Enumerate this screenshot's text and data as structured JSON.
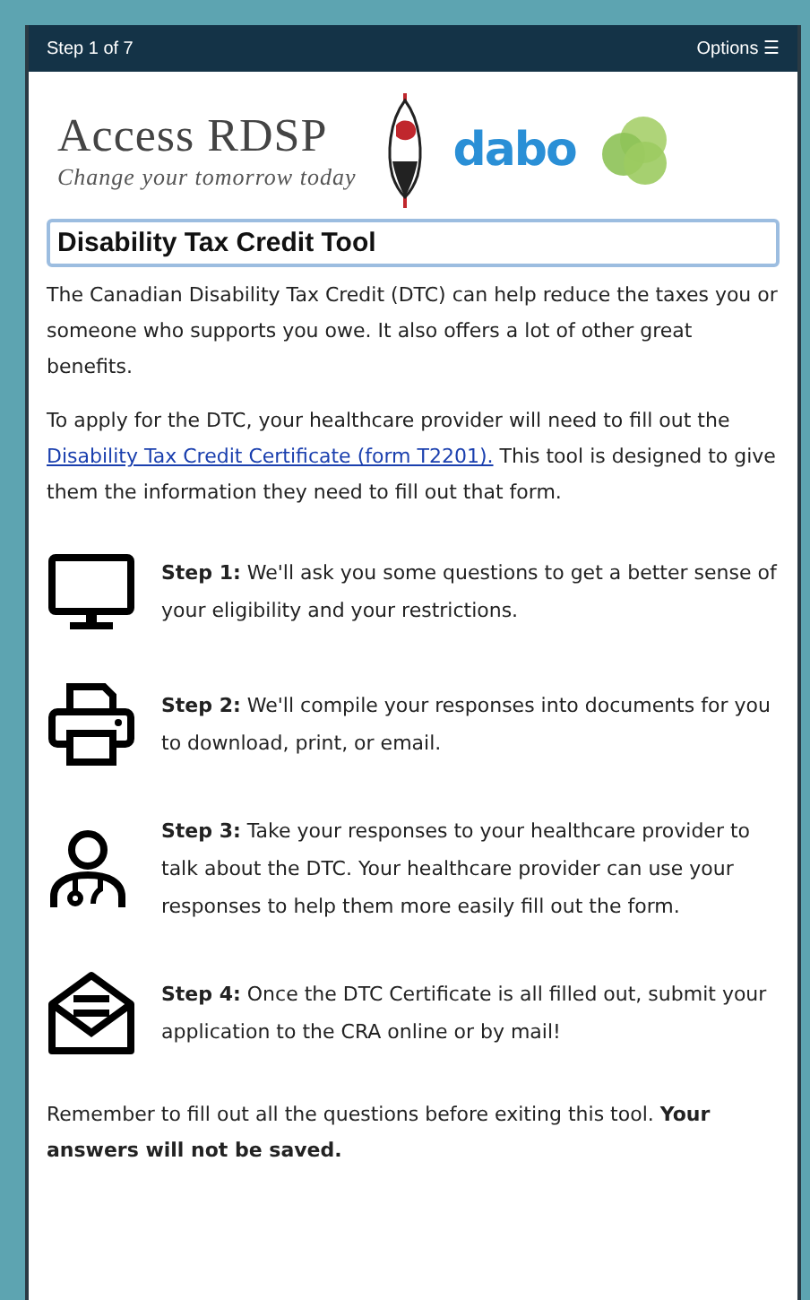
{
  "header": {
    "step": "Step 1 of 7",
    "options": "Options ☰"
  },
  "logos": {
    "title": "Access RDSP",
    "tagline": "Change your tomorrow today",
    "partner": "dabo"
  },
  "tool_title": "Disability Tax Credit Tool",
  "intro": "The Canadian Disability Tax Credit (DTC) can help reduce the taxes you or someone who supports you owe. It also offers a lot of other great benefits.",
  "apply": {
    "before": "To apply for the DTC, your healthcare provider will need to fill out the ",
    "link": "Disability Tax Credit Certificate (form T2201).",
    "after": " This tool is designed to give them the information they need to fill out that form."
  },
  "steps": [
    {
      "kind": "monitor",
      "text": "**Step 1:** We'll ask you some questions to get a better sense of your eligibility and your restrictions."
    },
    {
      "kind": "printer",
      "text": "**Step 2:** We'll compile your responses into documents for you to download, print, or email."
    },
    {
      "kind": "person",
      "text": "**Step 3:** Take your responses to your healthcare provider to talk about the DTC. Your healthcare provider can use your responses to help them more easily fill out the form."
    },
    {
      "kind": "envelope",
      "text": "**Step 4:** Once the DTC Certificate is all filled out, submit your application to the CRA online or by mail!"
    }
  ],
  "reminder": "Remember to fill out all the questions before exiting this tool. **Your answers will not be saved.**"
}
